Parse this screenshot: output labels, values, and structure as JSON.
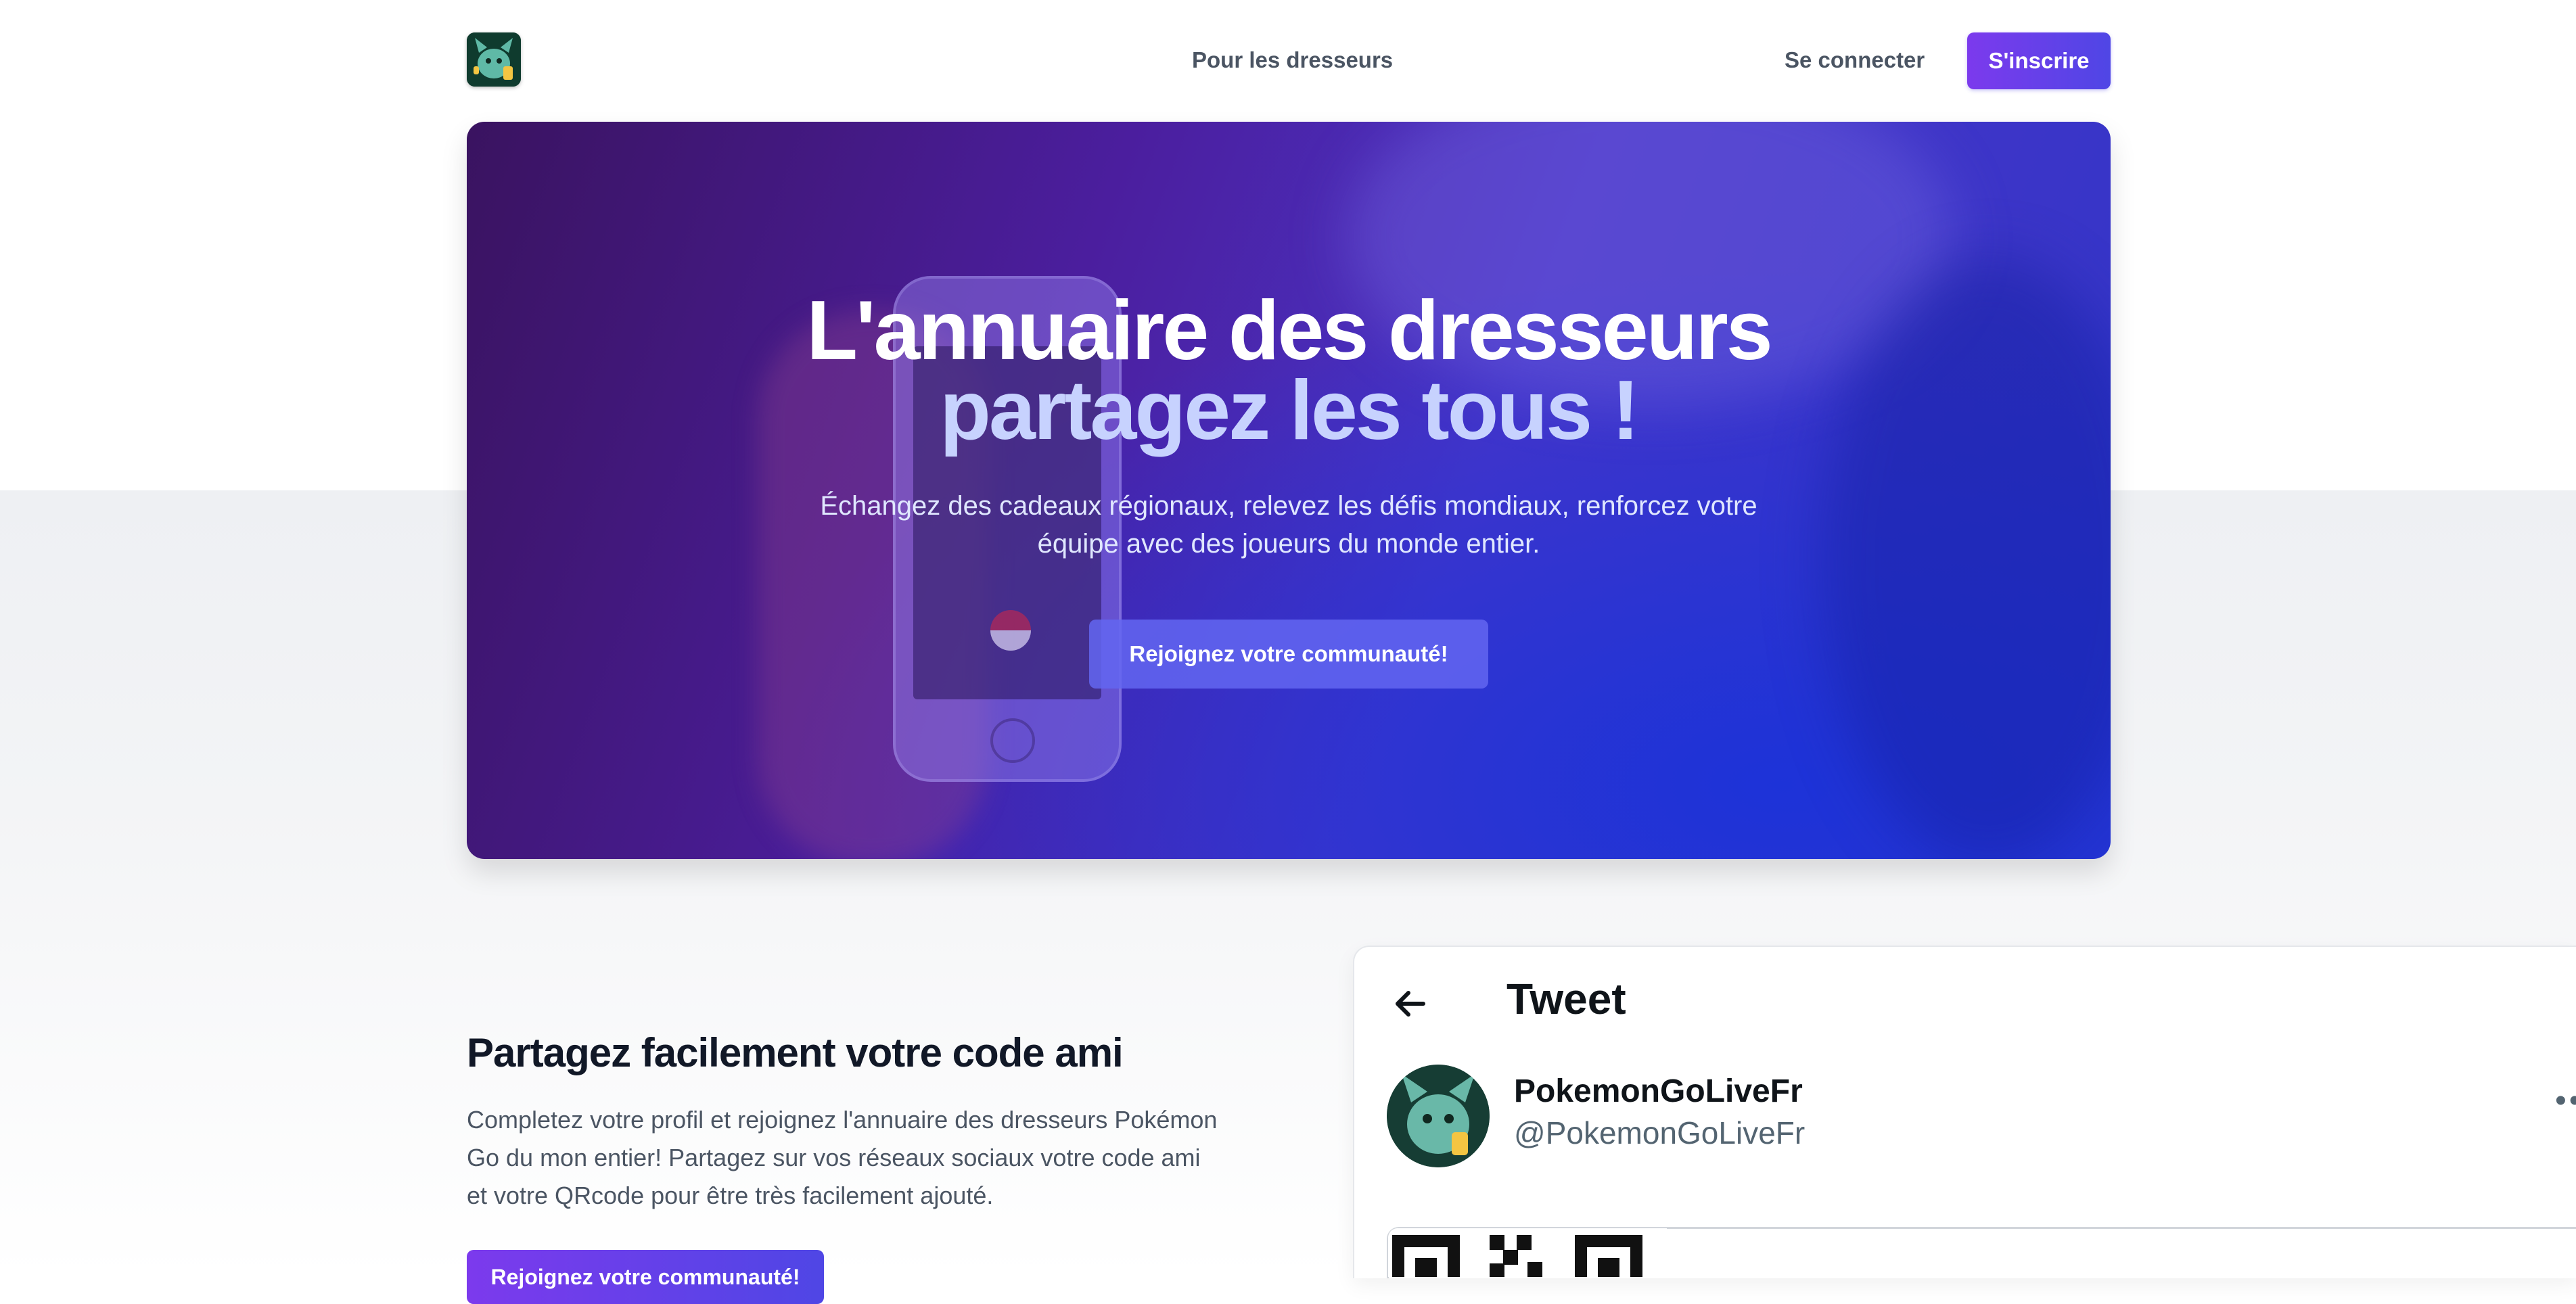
{
  "nav": {
    "trainers_label": "Pour les dresseurs",
    "login_label": "Se connecter",
    "signup_label": "S'inscrire"
  },
  "hero": {
    "title_line1": "L'annuaire des dresseurs",
    "title_line2": "partagez les tous !",
    "subtitle": "Échangez des cadeaux régionaux, relevez les défis mondiaux, renforcez votre équipe avec des joueurs du monde entier.",
    "cta_label": "Rejoignez votre communauté!"
  },
  "share_section": {
    "title": "Partagez facilement votre code ami",
    "text": "Completez votre profil et rejoignez l'annuaire des dresseurs Pokémon Go du mon entier! Partagez sur vos réseaux sociaux votre code ami et votre QRcode pour être très facilement ajouté.",
    "cta_label": "Rejoignez votre communauté!"
  },
  "tweet": {
    "header": "Tweet",
    "name": "PokemonGoLiveFr",
    "handle": "@PokemonGoLiveFr",
    "more": "••"
  },
  "colors": {
    "accent_start": "#7c3aed",
    "accent_end": "#4f46e5",
    "hero_title_highlight": "#c7d2fe"
  },
  "icons": {
    "logo": "pokemon-mascot-logo",
    "back": "arrow-left-icon",
    "more": "more-dots-icon"
  }
}
